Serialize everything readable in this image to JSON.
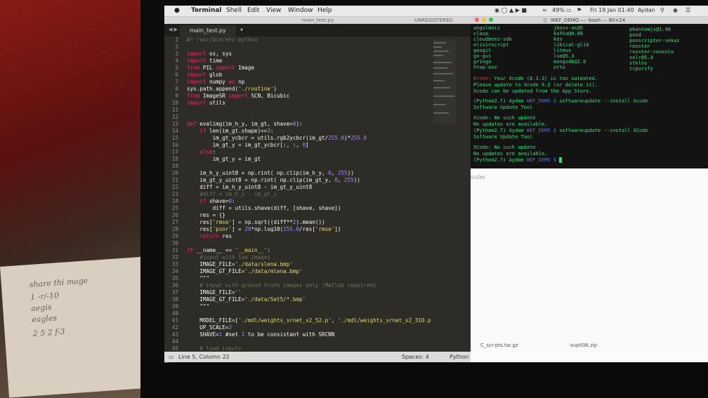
{
  "menubar": {
    "app": "Terminal",
    "items": [
      "Shell",
      "Edit",
      "View",
      "Window",
      "Help"
    ],
    "battery": "49%",
    "clock": "Fri 19 Jan 01:40",
    "user": "Aydan"
  },
  "editor": {
    "window_title": "main_test.py",
    "registration": "UNREGISTERED",
    "tab_label": "main_test.py",
    "status_position": "Line 5, Column 22",
    "status_spaces": "Spaces: 4",
    "status_syntax": "Python",
    "lines": [
      {
        "n": "1",
        "t": "#! /usr/bin/env python"
      },
      {
        "n": "2",
        "t": ""
      },
      {
        "n": "3",
        "t": "import os, sys"
      },
      {
        "n": "4",
        "t": "import time"
      },
      {
        "n": "5",
        "t": "from PIL import Image"
      },
      {
        "n": "6",
        "t": "import glob"
      },
      {
        "n": "7",
        "t": "import numpy as np"
      },
      {
        "n": "8",
        "t": "sys.path.append('./routine')"
      },
      {
        "n": "9",
        "t": "from ImageSR import SCN, Bicubic"
      },
      {
        "n": "10",
        "t": "import utils"
      },
      {
        "n": "11",
        "t": ""
      },
      {
        "n": "12",
        "t": ""
      },
      {
        "n": "13",
        "t": "def evalimg(im_h_y, im_gt, shave=0):"
      },
      {
        "n": "14",
        "t": "    if len(im_gt.shape)==3:"
      },
      {
        "n": "15",
        "t": "        im_gt_ycbcr = utils.rgb2ycbcr(im_gt/255.0)*255.0"
      },
      {
        "n": "16",
        "t": "        im_gt_y = im_gt_ycbcr[:, :, 0]"
      },
      {
        "n": "17",
        "t": "    else:"
      },
      {
        "n": "18",
        "t": "        im_gt_y = im_gt"
      },
      {
        "n": "19",
        "t": ""
      },
      {
        "n": "20",
        "t": "    im_h_y_uint8 = np.rint( np.clip(im_h_y, 0, 255))"
      },
      {
        "n": "21",
        "t": "    im_gt_y_uint8 = np.rint( np.clip(im_gt_y, 0, 255))"
      },
      {
        "n": "22",
        "t": "    diff = im_h_y_uint8 - im_gt_y_uint8"
      },
      {
        "n": "23",
        "t": "    #diff = im_h_y - im_gt_y"
      },
      {
        "n": "24",
        "t": "    if shave>0:"
      },
      {
        "n": "25",
        "t": "        diff = utils.shave(diff, [shave, shave])"
      },
      {
        "n": "26",
        "t": "    res = {}"
      },
      {
        "n": "27",
        "t": "    res['rmse'] = np.sqrt((diff**2).mean())"
      },
      {
        "n": "28",
        "t": "    res['psnr'] = 20*np.log10(255.0/res['rmse'])"
      },
      {
        "n": "29",
        "t": "    return res"
      },
      {
        "n": "30",
        "t": ""
      },
      {
        "n": "31",
        "t": "if __name__ == '__main__':"
      },
      {
        "n": "32",
        "t": "    #input with two images"
      },
      {
        "n": "33",
        "t": "    IMAGE_FILE='./data/slena.bmp'"
      },
      {
        "n": "34",
        "t": "    IMAGE_GT_FILE='./data/mlena.bmp'"
      },
      {
        "n": "35",
        "t": "    \"\"\""
      },
      {
        "n": "36",
        "t": "    # input with ground truth images only (Matlab required)"
      },
      {
        "n": "37",
        "t": "    IMAGE_FILE=''"
      },
      {
        "n": "38",
        "t": "    IMAGE_GT_FILE='./data/Set5/*.bmp'"
      },
      {
        "n": "39",
        "t": "    \"\"\""
      },
      {
        "n": "40",
        "t": ""
      },
      {
        "n": "41",
        "t": "    MODEL_FILE=['./mdl/weights_srnet_x2_52.p', './mdl/weights_srnet_x2_310.p']"
      },
      {
        "n": "42",
        "t": "    UP_SCALE=2"
      },
      {
        "n": "43",
        "t": "    SHAVE=1 #set 1 to be consistant with SRCNN"
      },
      {
        "n": "44",
        "t": ""
      },
      {
        "n": "45",
        "t": "    # load inputs"
      },
      {
        "n": "46",
        "t": "    im_gt = []"
      },
      {
        "n": "47",
        "t": "    files_gt = glob.glob(IMAGE_GT_FILE)"
      }
    ]
  },
  "terminal": {
    "window_title": "WEF_DEMO — -bash — 80×24",
    "col1": [
      "angolmois",
      "clasp",
      "cloudbees-sdk",
      "elixirscript",
      "geogit",
      "go-gui",
      "gringo",
      "htop-osx"
    ],
    "col2": [
      "jboss-as@5",
      "kafka@0.80",
      "kes",
      "libical-glib",
      "litmus",
      "lua@5.3",
      "mongodb@2.6",
      "otto"
    ],
    "col3": [
      "phantomjs@1.98",
      "pond",
      "ponscripter-sekai",
      "rexster",
      "rexster-console",
      "solr@5.4",
      "stklos",
      "tcpurify"
    ],
    "error_label": "Error:",
    "error_msg": " Your Xcode (8.3.3) is too outdated.",
    "line2": "Please update to Xcode 9.2 (or delete it).",
    "line3": "Xcode can be updated from the App Store.",
    "prompt_env": "(Python2.7)",
    "prompt_user": "Aydan",
    "prompt_dir": "WEF_DEMO $",
    "cmd1": " softwareupdate --install Xcode",
    "out1": "Software Update Tool",
    "out2": "Xcode: No such update",
    "out3": "No updates are available.",
    "cmd2": " softwareupdate --install XCode",
    "out4": "Software Update Tool",
    "out5": "XCode: No such update",
    "out6": "No updates are available."
  },
  "finder": {
    "label": "outer",
    "files": [
      "C_scr-pts.tar.gz",
      "sup006.zip"
    ]
  },
  "paper": {
    "lines": [
      "share thi mage",
      "1 -r/-10",
      "aegis",
      "eagles",
      "2 5 2 f-3"
    ]
  }
}
